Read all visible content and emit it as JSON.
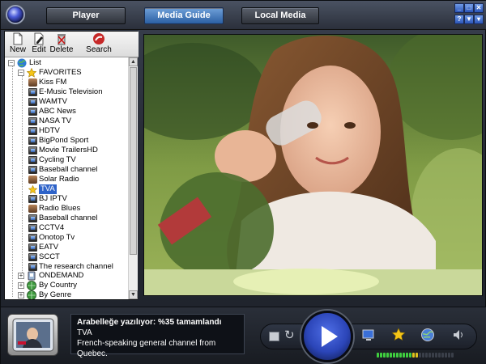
{
  "tabs": [
    {
      "label": "Player",
      "active": false
    },
    {
      "label": "Media Guide",
      "active": true
    },
    {
      "label": "Local Media",
      "active": false
    }
  ],
  "window_controls": [
    "minimize",
    "maximize",
    "close",
    "help",
    "menu",
    "pin"
  ],
  "toolbar": {
    "new_label": "New",
    "edit_label": "Edit",
    "delete_label": "Delete",
    "search_label": "Search"
  },
  "tree": {
    "root_label": "List",
    "favorites_label": "FAVORITES",
    "favorites": [
      {
        "label": "Kiss FM",
        "icon": "radio-icon"
      },
      {
        "label": "E-Music Television",
        "icon": "tv-icon"
      },
      {
        "label": "WAMTV",
        "icon": "tv-icon"
      },
      {
        "label": "ABC News",
        "icon": "tv-icon"
      },
      {
        "label": "NASA TV",
        "icon": "tv-icon"
      },
      {
        "label": "HDTV",
        "icon": "tv-icon"
      },
      {
        "label": "BigPond Sport",
        "icon": "tv-icon"
      },
      {
        "label": "Movie TrailersHD",
        "icon": "tv-icon"
      },
      {
        "label": "Cycling TV",
        "icon": "tv-icon"
      },
      {
        "label": "Baseball channel",
        "icon": "tv-icon"
      },
      {
        "label": "Solar Radio",
        "icon": "radio-icon"
      },
      {
        "label": "TVA",
        "icon": "star-icon",
        "selected": true
      },
      {
        "label": "BJ IPTV",
        "icon": "tv-icon"
      },
      {
        "label": "Radio Blues",
        "icon": "radio-icon"
      },
      {
        "label": "Baseball channel",
        "icon": "tv-icon"
      },
      {
        "label": "CCTV4",
        "icon": "tv-icon"
      },
      {
        "label": "Onotop Tv",
        "icon": "tv-icon"
      },
      {
        "label": "EATV",
        "icon": "tv-icon"
      },
      {
        "label": "SCCT",
        "icon": "tv-icon"
      },
      {
        "label": "The research channel",
        "icon": "tv-icon"
      }
    ],
    "ondemand_label": "ONDEMAND",
    "by_country_label": "By Country",
    "by_genre_label": "By Genre"
  },
  "now_playing": {
    "status": "Arabelleğe yazılıyor: %35 tamamlandı",
    "channel": "TVA",
    "description": "French-speaking general channel from Quebec."
  },
  "volume_level": 0.55,
  "colors": {
    "accent": "#2e63c9",
    "play_button": "#2b45b8"
  }
}
